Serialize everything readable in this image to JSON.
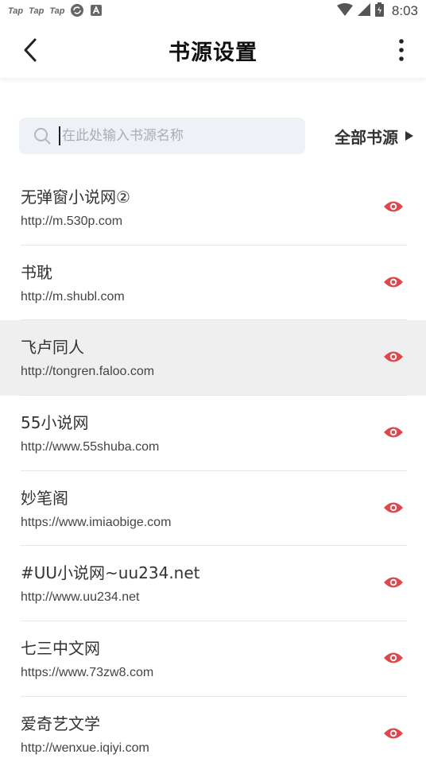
{
  "status_bar": {
    "apps": [
      "Tap",
      "Tap",
      "Tap"
    ],
    "time": "8:03"
  },
  "header": {
    "title": "书源设置"
  },
  "search": {
    "placeholder": "在此处输入书源名称",
    "value": ""
  },
  "filter": {
    "label": "全部书源"
  },
  "colors": {
    "accent": "#e0474c",
    "search_bg": "#eef1f5",
    "highlight_bg": "#efefef"
  },
  "sources": [
    {
      "name": "无弹窗小说网②",
      "url": "http://m.530p.com"
    },
    {
      "name": "书耽",
      "url": "http://m.shubl.com"
    },
    {
      "name": "飞卢同人",
      "url": "http://tongren.faloo.com"
    },
    {
      "name": "55小说网",
      "url": "http://www.55shuba.com"
    },
    {
      "name": "妙笔阁",
      "url": "https://www.imiaobige.com"
    },
    {
      "name": "#UU小说网~uu234.net",
      "url": "http://www.uu234.net"
    },
    {
      "name": "七三中文网",
      "url": "https://www.73zw8.com"
    },
    {
      "name": "爱奇艺文学",
      "url": "http://wenxue.iqiyi.com"
    }
  ]
}
